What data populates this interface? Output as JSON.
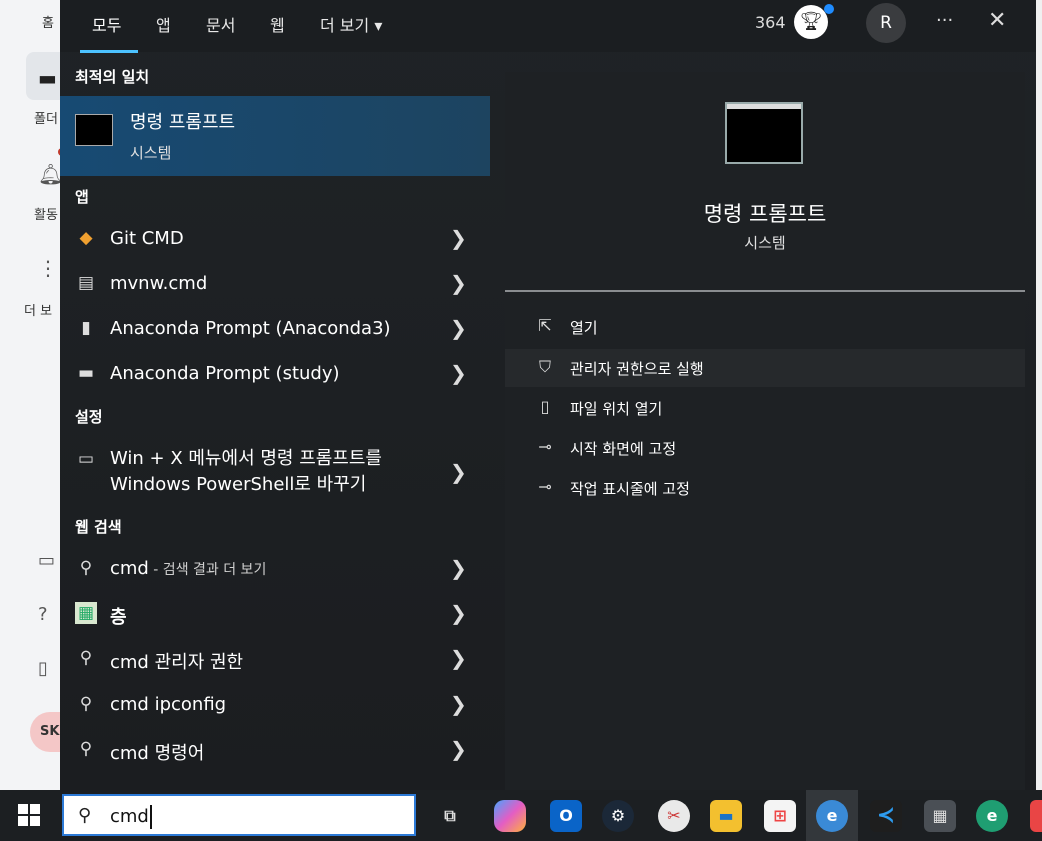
{
  "background_app": {
    "home_label": "홈",
    "folder_label": "폴더",
    "activity_label": "활동",
    "more_label": "더 보",
    "avatar_initials": "SK"
  },
  "topbar": {
    "tabs": [
      {
        "label": "모두",
        "active": true
      },
      {
        "label": "앱"
      },
      {
        "label": "문서"
      },
      {
        "label": "웹"
      },
      {
        "label": "더 보기 ▾"
      }
    ],
    "points": "364",
    "user_initial": "R",
    "more_glyph": "···",
    "close_glyph": "✕"
  },
  "sections": {
    "best_match": "최적의 일치",
    "apps": "앱",
    "settings": "설정",
    "web_search": "웹 검색"
  },
  "best_match": {
    "title": "명령 프롬프트",
    "subtitle": "시스템"
  },
  "apps": [
    {
      "label": "Git CMD",
      "icon": "git-icon"
    },
    {
      "label": "mvnw.cmd",
      "icon": "file-icon"
    },
    {
      "label": "Anaconda Prompt (Anaconda3)",
      "icon": "document-icon"
    },
    {
      "label": "Anaconda Prompt (study)",
      "icon": "terminal-icon"
    }
  ],
  "settings": [
    {
      "line1": "Win + X 메뉴에서 명령 프롬프트를",
      "line2": "Windows PowerShell로 바꾸기",
      "icon": "monitor-icon"
    }
  ],
  "web": [
    {
      "label": "cmd",
      "suffix": " - 검색 결과 더 보기",
      "icon": "search-icon"
    },
    {
      "label": "층",
      "icon": "image-icon"
    },
    {
      "label": "cmd 관리자 권한",
      "icon": "search-icon"
    },
    {
      "label": "cmd ipconfig",
      "icon": "search-icon"
    },
    {
      "label": "cmd 명령어",
      "icon": "search-icon"
    }
  ],
  "preview": {
    "title": "명령 프롬프트",
    "subtitle": "시스템",
    "actions": [
      {
        "label": "열기",
        "icon": "open-icon"
      },
      {
        "label": "관리자 권한으로 실행",
        "icon": "shield-icon",
        "highlighted": true
      },
      {
        "label": "파일 위치 열기",
        "icon": "folder-icon"
      },
      {
        "label": "시작 화면에 고정",
        "icon": "pin-icon"
      },
      {
        "label": "작업 표시줄에 고정",
        "icon": "pin-icon"
      }
    ]
  },
  "taskbar": {
    "search_value": "cmd",
    "apps": [
      "task-view-icon",
      "copilot-icon",
      "outlook-icon",
      "steam-icon",
      "snipping-tool-icon",
      "file-explorer-icon",
      "microsoft-store-icon",
      "edge-dev-icon",
      "vscode-icon",
      "calculator-icon",
      "edge-icon"
    ]
  },
  "colors": {
    "accent": "#4cc2ff",
    "selection": "#174a73",
    "flyout_bg": "#1f2326"
  }
}
